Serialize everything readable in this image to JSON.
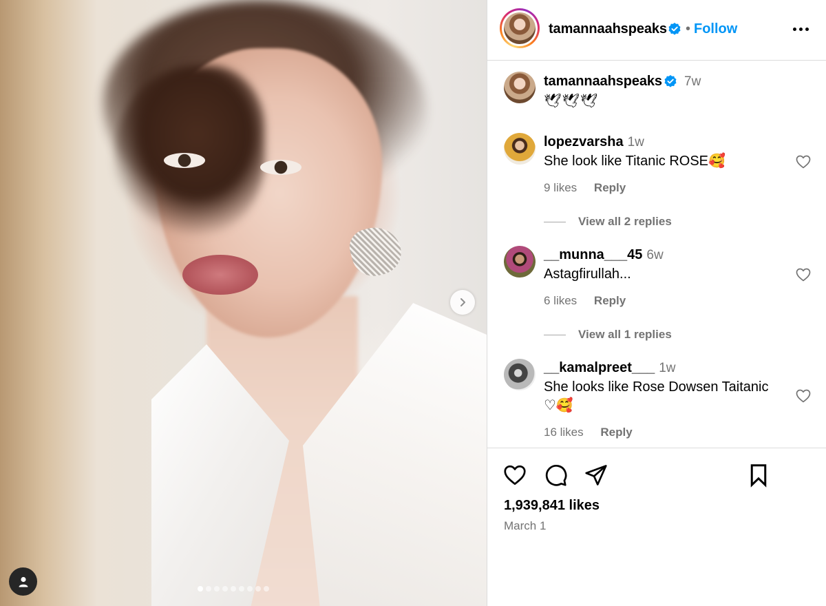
{
  "post": {
    "username": "tamannaahspeaks",
    "follow_label": "Follow",
    "separator": "•",
    "caption_time": "7w",
    "caption_text": "🕊🕊🕊",
    "likes": "1,939,841 likes",
    "date": "March 1",
    "carousel_total": 9,
    "carousel_active": 1
  },
  "comments": [
    {
      "username": "lopezvarsha",
      "time": "1w",
      "text": "She look like Titanic ROSE🥰",
      "likes": "9 likes",
      "reply_label": "Reply",
      "view_replies": "View all 2 replies"
    },
    {
      "username": "__munna___45",
      "time": "6w",
      "text": "Astagfirullah...",
      "likes": "6 likes",
      "reply_label": "Reply",
      "view_replies": "View all 1 replies"
    },
    {
      "username": "__kamalpreet___",
      "time": "1w",
      "text": "She looks like Rose Dowsen Taitanic ♡🥰",
      "likes": "16 likes",
      "reply_label": "Reply"
    }
  ],
  "icons": {
    "verified": "verified-badge-icon",
    "more": "more-options-icon",
    "like": "heart-icon",
    "comment": "comment-bubble-icon",
    "share": "paper-plane-icon",
    "save": "bookmark-icon",
    "next": "chevron-right-icon",
    "tagged": "user-tag-icon"
  },
  "colors": {
    "accent": "#0095f6",
    "secondary_text": "#737373",
    "border": "#dbdbdb",
    "verified": "#0095f6"
  }
}
